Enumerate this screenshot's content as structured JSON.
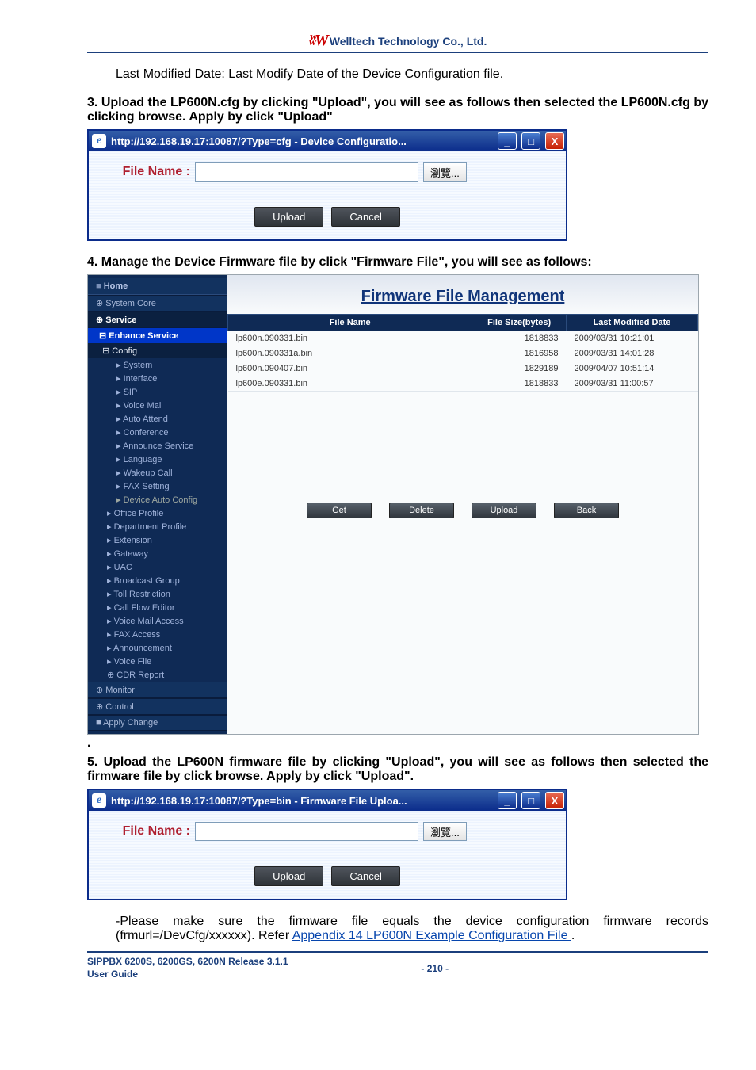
{
  "header": {
    "company": "Welltech Technology Co., Ltd."
  },
  "body": {
    "last_modified_line": "Last Modified Date: Last Modify Date of the Device Configuration file.",
    "step3": "3. Upload the LP600N.cfg by clicking \"Upload\", you will see as follows then selected the LP600N.cfg by clicking browse. Apply by click \"Upload\"",
    "step4": "4. Manage the Device Firmware file by click \"Firmware File\", you will see as follows:",
    "dot": ".",
    "step5": "5. Upload the LP600N firmware file by clicking \"Upload\", you will see as follows then selected the firmware file by click browse. Apply by click \"Upload\".",
    "note_prefix": "-Please make sure the firmware file equals the device configuration firmware records (frmurl=/DevCfg/xxxxxx). Refer ",
    "note_link": "Appendix 14 LP600N Example Configuration File ",
    "note_suffix": "."
  },
  "dialog_cfg": {
    "title": "http://192.168.19.17:10087/?Type=cfg - Device Configuratio...",
    "file_name_label": "File Name :",
    "browse": "瀏覽...",
    "upload": "Upload",
    "cancel": "Cancel"
  },
  "dialog_bin": {
    "title": "http://192.168.19.17:10087/?Type=bin - Firmware File Uploa...",
    "file_name_label": "File Name :",
    "browse": "瀏覽...",
    "upload": "Upload",
    "cancel": "Cancel"
  },
  "fw": {
    "title": "Firmware File Management",
    "cols": {
      "name": "File Name",
      "size": "File Size(bytes)",
      "date": "Last Modified Date"
    },
    "rows": [
      {
        "name": "lp600n.090331.bin",
        "size": "1818833",
        "date": "2009/03/31 10:21:01"
      },
      {
        "name": "lp600n.090331a.bin",
        "size": "1816958",
        "date": "2009/03/31 14:01:28"
      },
      {
        "name": "lp600n.090407.bin",
        "size": "1829189",
        "date": "2009/04/07 10:51:14"
      },
      {
        "name": "lp600e.090331.bin",
        "size": "1818833",
        "date": "2009/03/31 11:00:57"
      }
    ],
    "buttons": {
      "get": "Get",
      "delete": "Delete",
      "upload": "Upload",
      "back": "Back"
    },
    "sidebar": {
      "home": "Home",
      "system_core": "System Core",
      "service": "Service",
      "enhance": "Enhance Service",
      "config": "Config",
      "items_l2": [
        "System",
        "Interface",
        "SIP",
        "Voice Mail",
        "Auto Attend",
        "Conference",
        "Announce Service",
        "Language",
        "Wakeup Call",
        "FAX Setting",
        "Device Auto Config"
      ],
      "items_l1": [
        "Office Profile",
        "Department Profile",
        "Extension",
        "Gateway",
        "UAC",
        "Broadcast Group",
        "Toll Restriction",
        "Call Flow Editor",
        "Voice Mail Access",
        "FAX Access",
        "Announcement",
        "Voice File"
      ],
      "cdr": "CDR Report",
      "monitor": "Monitor",
      "control": "Control",
      "apply": "Apply Change"
    }
  },
  "footer": {
    "line1": "SIPPBX 6200S, 6200GS, 6200N Release 3.1.1",
    "line2": "User Guide",
    "page": "- 210 -"
  }
}
